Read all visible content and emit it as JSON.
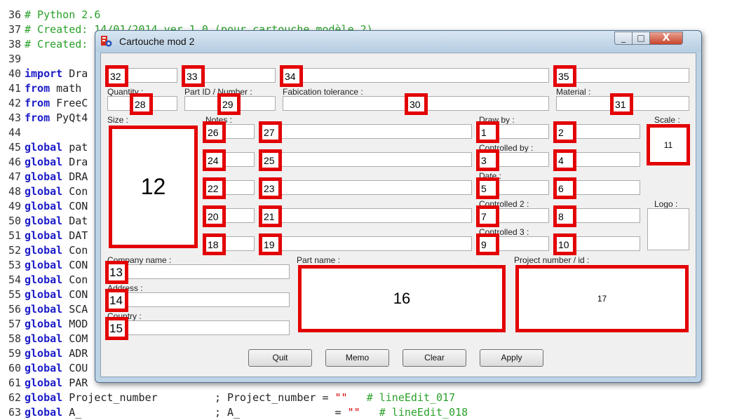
{
  "editor": {
    "lines": [
      {
        "n": "36",
        "kw": "",
        "rest": "",
        "cm": "# Python 2.6"
      },
      {
        "n": "37",
        "kw": "",
        "rest": "",
        "cm": "# Created: 14/01/2014 ver 1.0 (pour cartouche modèle 2)"
      },
      {
        "n": "38",
        "kw": "",
        "rest": "",
        "cm": "# Created:"
      },
      {
        "n": "39",
        "kw": "",
        "rest": "",
        "cm": ""
      },
      {
        "n": "40",
        "kw": "import",
        "rest": " Dra",
        "cm": ""
      },
      {
        "n": "41",
        "kw": "from",
        "rest": " math",
        "cm": ""
      },
      {
        "n": "42",
        "kw": "from",
        "rest": " FreeC",
        "cm": ""
      },
      {
        "n": "43",
        "kw": "from",
        "rest": " PyQt4",
        "cm": ""
      },
      {
        "n": "44",
        "kw": "",
        "rest": "",
        "cm": ""
      },
      {
        "n": "45",
        "kw": "global",
        "rest": " pat",
        "cm": ""
      },
      {
        "n": "46",
        "kw": "global",
        "rest": " Dra",
        "cm": ""
      },
      {
        "n": "47",
        "kw": "global",
        "rest": " DRA",
        "cm": ""
      },
      {
        "n": "48",
        "kw": "global",
        "rest": " Con",
        "cm": ""
      },
      {
        "n": "49",
        "kw": "global",
        "rest": " CON",
        "cm": ""
      },
      {
        "n": "50",
        "kw": "global",
        "rest": " Dat",
        "cm": ""
      },
      {
        "n": "51",
        "kw": "global",
        "rest": " DAT",
        "cm": ""
      },
      {
        "n": "52",
        "kw": "global",
        "rest": " Con",
        "cm": ""
      },
      {
        "n": "53",
        "kw": "global",
        "rest": " CON",
        "cm": ""
      },
      {
        "n": "54",
        "kw": "global",
        "rest": " Con",
        "cm": ""
      },
      {
        "n": "55",
        "kw": "global",
        "rest": " CON",
        "cm": ""
      },
      {
        "n": "56",
        "kw": "global",
        "rest": " SCA",
        "cm": ""
      },
      {
        "n": "57",
        "kw": "global",
        "rest": " MOD",
        "cm": ""
      },
      {
        "n": "58",
        "kw": "global",
        "rest": " COM",
        "cm": ""
      },
      {
        "n": "59",
        "kw": "global",
        "rest": " ADR",
        "cm": ""
      },
      {
        "n": "60",
        "kw": "global",
        "rest": " COU",
        "cm": ""
      },
      {
        "n": "61",
        "kw": "global",
        "rest": " PAR",
        "cm": ""
      }
    ],
    "line62": {
      "n": "62",
      "kw": "global",
      "a": " Project_number",
      "b": "; Project_number = ",
      "s": "\"\"",
      "cm": "# lineEdit_017"
    },
    "line63": {
      "n": "63",
      "kw": "global",
      "a": " A_",
      "b": "; A_",
      "eq": "= ",
      "s": "\"\"",
      "cm": "# lineEdit_018"
    }
  },
  "window": {
    "title": "Cartouche mod 2",
    "close_glyph": "X",
    "min_glyph": "_",
    "max_glyph": "□"
  },
  "labels": {
    "quantity": "Quantity :",
    "part_id": "Part ID / Number :",
    "fab_tol": "Fabication tolerance :",
    "material": "Material :",
    "size": "Size :",
    "notes": "Notes :",
    "draw_by": "Draw by :",
    "controlled_by": "Controlled by :",
    "date": "Date :",
    "controlled2": "Controlled 2 :",
    "controlled3": "Controlled 3 :",
    "scale": "Scale :",
    "logo": "Logo :",
    "company": "Company name :",
    "address": "Address :",
    "country": "Country :",
    "part_name": "Part name :",
    "project": "Project number / id :"
  },
  "badges": {
    "b1": "1",
    "b2": "2",
    "b3": "3",
    "b4": "4",
    "b5": "5",
    "b6": "6",
    "b7": "7",
    "b8": "8",
    "b9": "9",
    "b10": "10",
    "b11": "11",
    "b12": "12",
    "b13": "13",
    "b14": "14",
    "b15": "15",
    "b16": "16",
    "b17": "17",
    "b18": "18",
    "b19": "19",
    "b20": "20",
    "b21": "21",
    "b22": "22",
    "b23": "23",
    "b24": "24",
    "b25": "25",
    "b26": "26",
    "b27": "27",
    "b28": "28",
    "b29": "29",
    "b30": "30",
    "b31": "31",
    "b32": "32",
    "b33": "33",
    "b34": "34",
    "b35": "35"
  },
  "buttons": {
    "quit": "Quit",
    "memo": "Memo",
    "clear": "Clear",
    "apply": "Apply"
  },
  "colors": {
    "badge_border": "#e30000",
    "keyword": "#1b1bc8",
    "comment": "#2aa02a",
    "string": "#d40000"
  },
  "icons": {
    "app": "freecad-macro-icon"
  }
}
